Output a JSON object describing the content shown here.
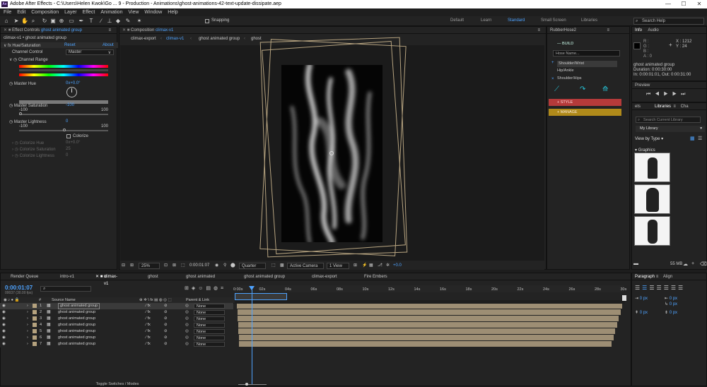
{
  "window": {
    "title": "Adobe After Effects - C:\\Users\\Helen Kwok\\Go ... 9 - Production - Animations\\ghost-animations-42-text-update-dissipate.aep",
    "logo": "Ae",
    "min": "—",
    "max": "☐",
    "close": "✕"
  },
  "menu": [
    "File",
    "Edit",
    "Composition",
    "Layer",
    "Effect",
    "Animation",
    "View",
    "Window",
    "Help"
  ],
  "toolbar": {
    "snapping": "Snapping",
    "workspaces": [
      "Default",
      "Learn",
      "Standard",
      "Small Screen",
      "Libraries"
    ],
    "active_workspace": "Standard",
    "search_placeholder": "Search Help"
  },
  "effect_controls": {
    "tab_label": "Effect Controls",
    "tab_layer": "ghost animated group",
    "layer_path": "climax-v1 • ghost animated group",
    "effect": "Hue/Saturation",
    "reset": "Reset",
    "about": "About",
    "channel_control_label": "Channel Control",
    "channel_control_value": "Master",
    "channel_range": "Channel Range",
    "master_hue": "Master Hue",
    "master_hue_value": "0x+0.0°",
    "master_saturation": "Master Saturation",
    "master_saturation_value": "-100",
    "sat_min": "-100",
    "sat_max": "100",
    "master_lightness": "Master Lightness",
    "master_lightness_value": "0",
    "light_min": "-100",
    "light_max": "100",
    "colorize": "Colorize",
    "colorize_hue": "Colorize Hue",
    "colorize_hue_value": "0x+0.0°",
    "colorize_saturation": "Colorize Saturation",
    "colorize_saturation_value": "25",
    "colorize_lightness": "Colorize Lightness",
    "colorize_lightness_value": "0"
  },
  "composition": {
    "tab_label": "Composition",
    "tab_comp": "climax-v1",
    "breadcrumbs": [
      "climax-export",
      "climax-v1",
      "ghost animated group",
      "ghost"
    ],
    "zoom": "25%",
    "timecode": "0:00:01:07",
    "resolution": "Quarter",
    "camera": "Active Camera",
    "views": "1 View",
    "exposure": "+0.0"
  },
  "rubberhose": {
    "title": "RubberHose2",
    "build": "BUILD",
    "hose_name_placeholder": "Hose Name...",
    "hose_items": [
      "Shoulder/Wrist",
      "Hip/Ankle",
      "Shoulder/Hips"
    ],
    "style": "STYLE",
    "manage": "MANAGE"
  },
  "info": {
    "tabs": [
      "Info",
      "Audio"
    ],
    "r": "R :",
    "g": "G :",
    "b": "B :",
    "a": "A :  0",
    "x": "X : 1212",
    "y": "Y : 24",
    "layer": "ghost animated group",
    "duration": "Duration: 0:00:30:00",
    "inout": "In: 0:00:01:01, Out: 0:00:31:00"
  },
  "preview": {
    "title": "Preview"
  },
  "libraries": {
    "tabs": [
      "ets",
      "Libraries",
      "Cha"
    ],
    "search_placeholder": "Search Current Library",
    "library": "My Library",
    "view_by": "View by Type",
    "section": "Graphics",
    "size": "55 MB"
  },
  "paragraph": {
    "tabs": [
      "Paragraph",
      "Align"
    ],
    "fields": [
      "0 px",
      "0 px",
      "0 px",
      "0 px",
      "0 px"
    ]
  },
  "timeline": {
    "tabs": [
      "Render Queue",
      "intro-v1",
      "climax-v1",
      "ghost",
      "ghost animated",
      "ghost animated group",
      "climax-export",
      "Fire Embers"
    ],
    "active_tab": "climax-v1",
    "timecode": "0:00:01:07",
    "fps_line": "00037 (30.00 fps)",
    "col_source": "Source Name",
    "col_parent": "Parent & Link",
    "layers": [
      {
        "num": "1",
        "name": "ghost animated group",
        "parent": "None"
      },
      {
        "num": "2",
        "name": "ghost animated group",
        "parent": "None"
      },
      {
        "num": "3",
        "name": "ghost animated group",
        "parent": "None"
      },
      {
        "num": "4",
        "name": "ghost animated group",
        "parent": "None"
      },
      {
        "num": "5",
        "name": "ghost animated group",
        "parent": "None"
      },
      {
        "num": "6",
        "name": "ghost animated group",
        "parent": "None"
      },
      {
        "num": "7",
        "name": "ghost animated group",
        "parent": "None"
      }
    ],
    "ruler": [
      "0:00s",
      "02s",
      "04s",
      "06s",
      "08s",
      "10s",
      "12s",
      "14s",
      "16s",
      "18s",
      "20s",
      "22s",
      "24s",
      "26s",
      "28s",
      "30s"
    ],
    "toggle": "Toggle Switches / Modes"
  },
  "colors": {
    "accent": "#4ea3ff",
    "build": "#1f7a86",
    "style": "#b53a3a",
    "manage": "#b08a1a",
    "layer_bar": "#9d8e74",
    "frame": "#b7a480"
  }
}
